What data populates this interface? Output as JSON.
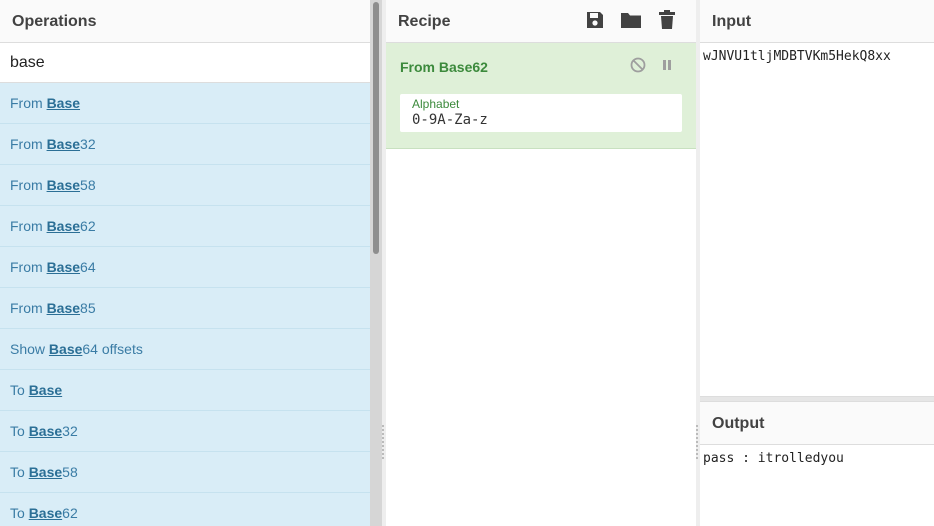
{
  "operations": {
    "title": "Operations",
    "search_value": "base",
    "items": [
      {
        "pre": "From ",
        "match": "Base",
        "post": ""
      },
      {
        "pre": "From ",
        "match": "Base",
        "post": "32"
      },
      {
        "pre": "From ",
        "match": "Base",
        "post": "58"
      },
      {
        "pre": "From ",
        "match": "Base",
        "post": "62"
      },
      {
        "pre": "From ",
        "match": "Base",
        "post": "64"
      },
      {
        "pre": "From ",
        "match": "Base",
        "post": "85"
      },
      {
        "pre": "Show ",
        "match": "Base",
        "post": "64 offsets"
      },
      {
        "pre": "To ",
        "match": "Base",
        "post": ""
      },
      {
        "pre": "To ",
        "match": "Base",
        "post": "32"
      },
      {
        "pre": "To ",
        "match": "Base",
        "post": "58"
      },
      {
        "pre": "To ",
        "match": "Base",
        "post": "62"
      }
    ]
  },
  "recipe": {
    "title": "Recipe",
    "icons": [
      "save-icon",
      "folder-icon",
      "trash-icon"
    ],
    "operation": {
      "name": "From Base62",
      "arg_label": "Alphabet",
      "arg_value": "0-9A-Za-z"
    }
  },
  "input": {
    "title": "Input",
    "value": "wJNVU1tljMDBTVKm5HekQ8xx"
  },
  "output": {
    "title": "Output",
    "value": "pass : itrolledyou"
  },
  "colors": {
    "op_bg": "#d9edf7",
    "recipe_op_bg": "#dff0d8",
    "accent_green": "#3c8a3c"
  }
}
